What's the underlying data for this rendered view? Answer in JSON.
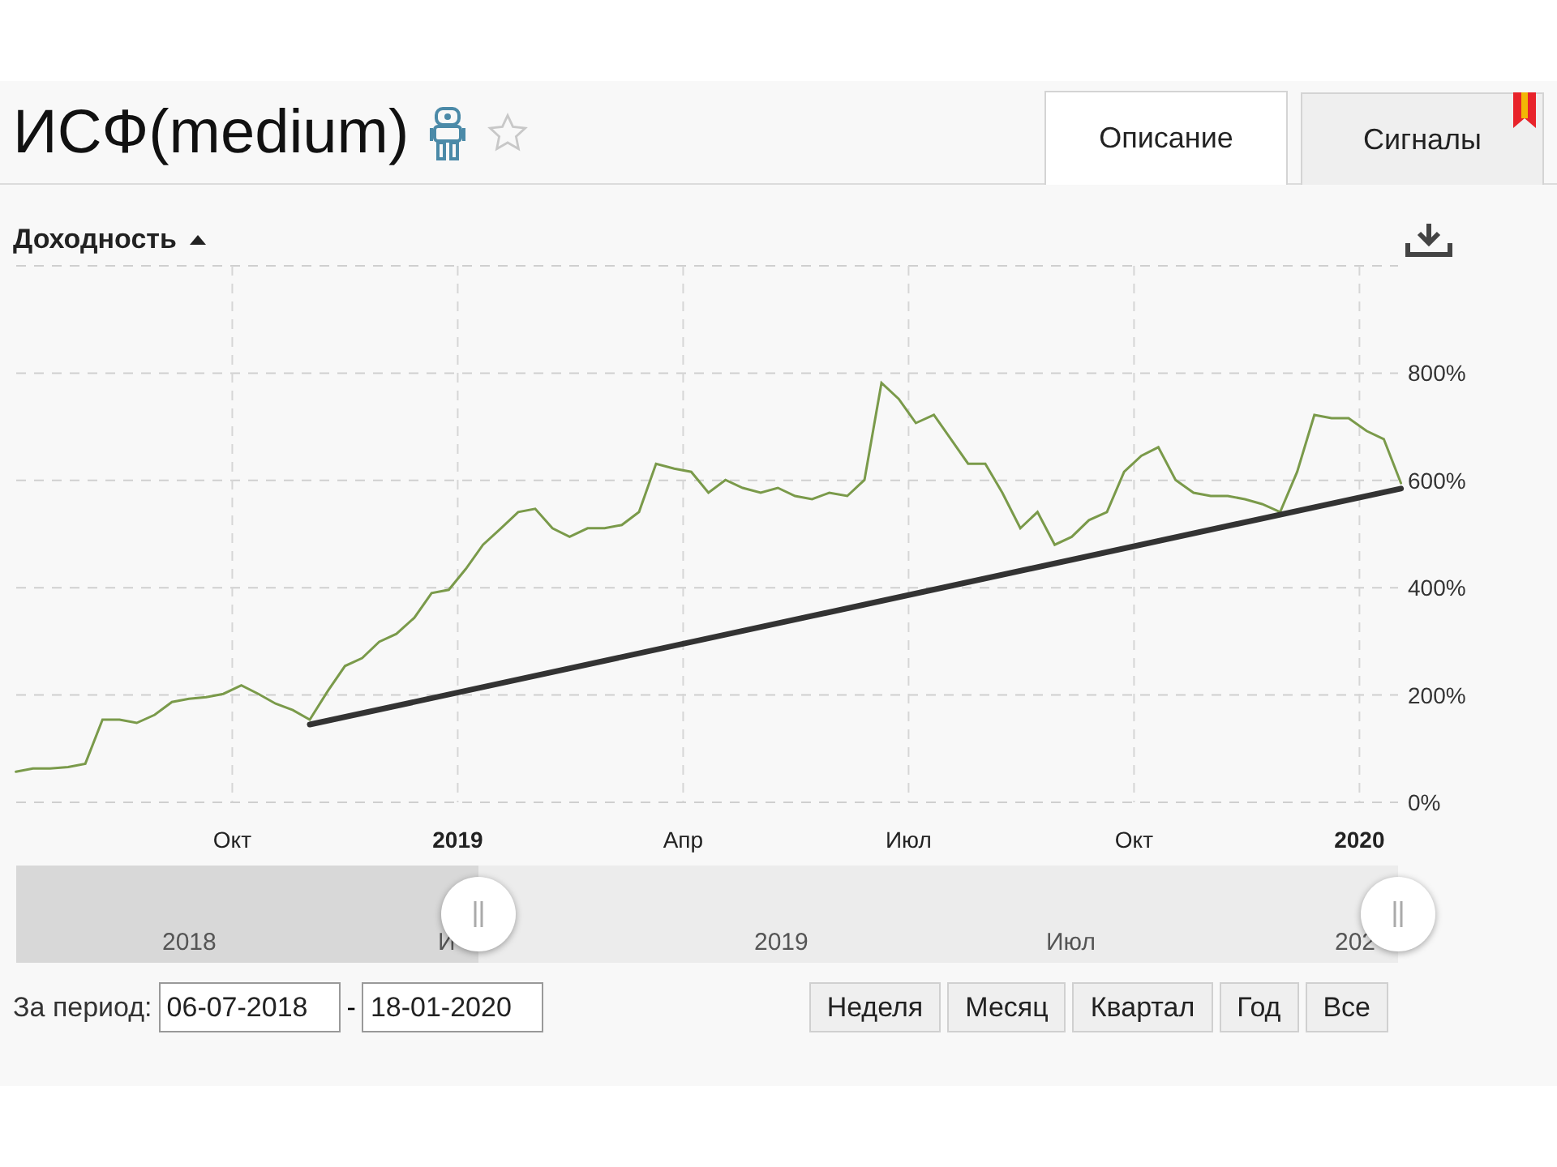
{
  "header": {
    "title": "ИСФ(medium)"
  },
  "tabs": [
    {
      "label": "Описание",
      "selected": true
    },
    {
      "label": "Сигналы",
      "selected": false
    }
  ],
  "chart": {
    "title": "Доходность",
    "chart_data": {
      "type": "line",
      "x": [
        2018.51,
        2018.529,
        2018.548,
        2018.568,
        2018.587,
        2018.606,
        2018.625,
        2018.644,
        2018.664,
        2018.683,
        2018.702,
        2018.721,
        2018.74,
        2018.76,
        2018.779,
        2018.798,
        2018.817,
        2018.836,
        2018.856,
        2018.875,
        2018.894,
        2018.913,
        2018.932,
        2018.952,
        2018.971,
        2018.99,
        2019.009,
        2019.028,
        2019.048,
        2019.067,
        2019.086,
        2019.105,
        2019.124,
        2019.144,
        2019.163,
        2019.182,
        2019.201,
        2019.22,
        2019.24,
        2019.259,
        2019.278,
        2019.297,
        2019.316,
        2019.336,
        2019.355,
        2019.374,
        2019.393,
        2019.412,
        2019.432,
        2019.451,
        2019.47,
        2019.489,
        2019.508,
        2019.528,
        2019.547,
        2019.566,
        2019.585,
        2019.604,
        2019.624,
        2019.643,
        2019.662,
        2019.681,
        2019.7,
        2019.72,
        2019.739,
        2019.758,
        2019.777,
        2019.796,
        2019.816,
        2019.835,
        2019.854,
        2019.873,
        2019.892,
        2019.912,
        2019.931,
        2019.95,
        2019.969,
        2019.988,
        2020.008,
        2020.027,
        2020.046
      ],
      "series": [
        {
          "color": "#7a9a4a",
          "values": [
            57,
            63,
            63,
            66,
            72,
            154,
            154,
            148,
            163,
            187,
            193,
            196,
            202,
            218,
            202,
            184,
            172,
            154,
            208,
            254,
            269,
            299,
            314,
            344,
            390,
            396,
            435,
            480,
            511,
            541,
            547,
            511,
            495,
            511,
            511,
            517,
            541,
            631,
            622,
            616,
            577,
            601,
            586,
            577,
            586,
            571,
            565,
            577,
            571,
            601,
            782,
            752,
            707,
            722,
            677,
            631,
            631,
            577,
            511,
            541,
            480,
            495,
            526,
            541,
            616,
            646,
            662,
            601,
            577,
            571,
            571,
            565,
            556,
            541,
            616,
            722,
            716,
            716,
            692,
            677,
            595
          ]
        },
        {
          "color": "#333333",
          "values": [
            null,
            null,
            null,
            null,
            null,
            null,
            null,
            null,
            null,
            null,
            null,
            null,
            null,
            null,
            null,
            null,
            null,
            145,
            null,
            null,
            null,
            null,
            null,
            null,
            null,
            null,
            null,
            null,
            null,
            null,
            null,
            null,
            null,
            null,
            null,
            null,
            null,
            null,
            null,
            null,
            null,
            null,
            null,
            null,
            null,
            null,
            null,
            null,
            null,
            null,
            null,
            null,
            null,
            null,
            null,
            null,
            null,
            null,
            null,
            null,
            null,
            null,
            null,
            null,
            null,
            null,
            null,
            null,
            null,
            null,
            null,
            null,
            null,
            null,
            null,
            null,
            null,
            null,
            null,
            null,
            585
          ]
        }
      ],
      "xlim": [
        2018.505,
        2020.05
      ],
      "ylim": [
        0,
        1000
      ],
      "grid": true,
      "xticks": [
        {
          "value": 2018.75,
          "label": "Окт"
        },
        {
          "value": 2019,
          "label": "**2019**"
        },
        {
          "value": 2019.25,
          "label": "Апр"
        },
        {
          "value": 2019.5,
          "label": "Июл"
        },
        {
          "value": 2019.75,
          "label": "Окт"
        },
        {
          "value": 2020,
          "label": "**2020**"
        }
      ],
      "yticks": [
        {
          "value": 0,
          "label": "0%"
        },
        {
          "value": 200,
          "label": "200%"
        },
        {
          "value": 400,
          "label": "400%"
        },
        {
          "value": 600,
          "label": "600%"
        },
        {
          "value": 800,
          "label": "800%"
        }
      ]
    }
  },
  "navigator": {
    "labels": [
      "2018",
      "И",
      "2019",
      "Июл",
      "202"
    ],
    "range_start": {
      "level": 0.335
    },
    "range_end": {
      "level": 1.0
    }
  },
  "period": {
    "label": "За период:",
    "from": "06-07-2018",
    "separator": "-",
    "to": "18-01-2020"
  },
  "range_buttons": [
    "Неделя",
    "Месяц",
    "Квартал",
    "Год",
    "Все"
  ]
}
